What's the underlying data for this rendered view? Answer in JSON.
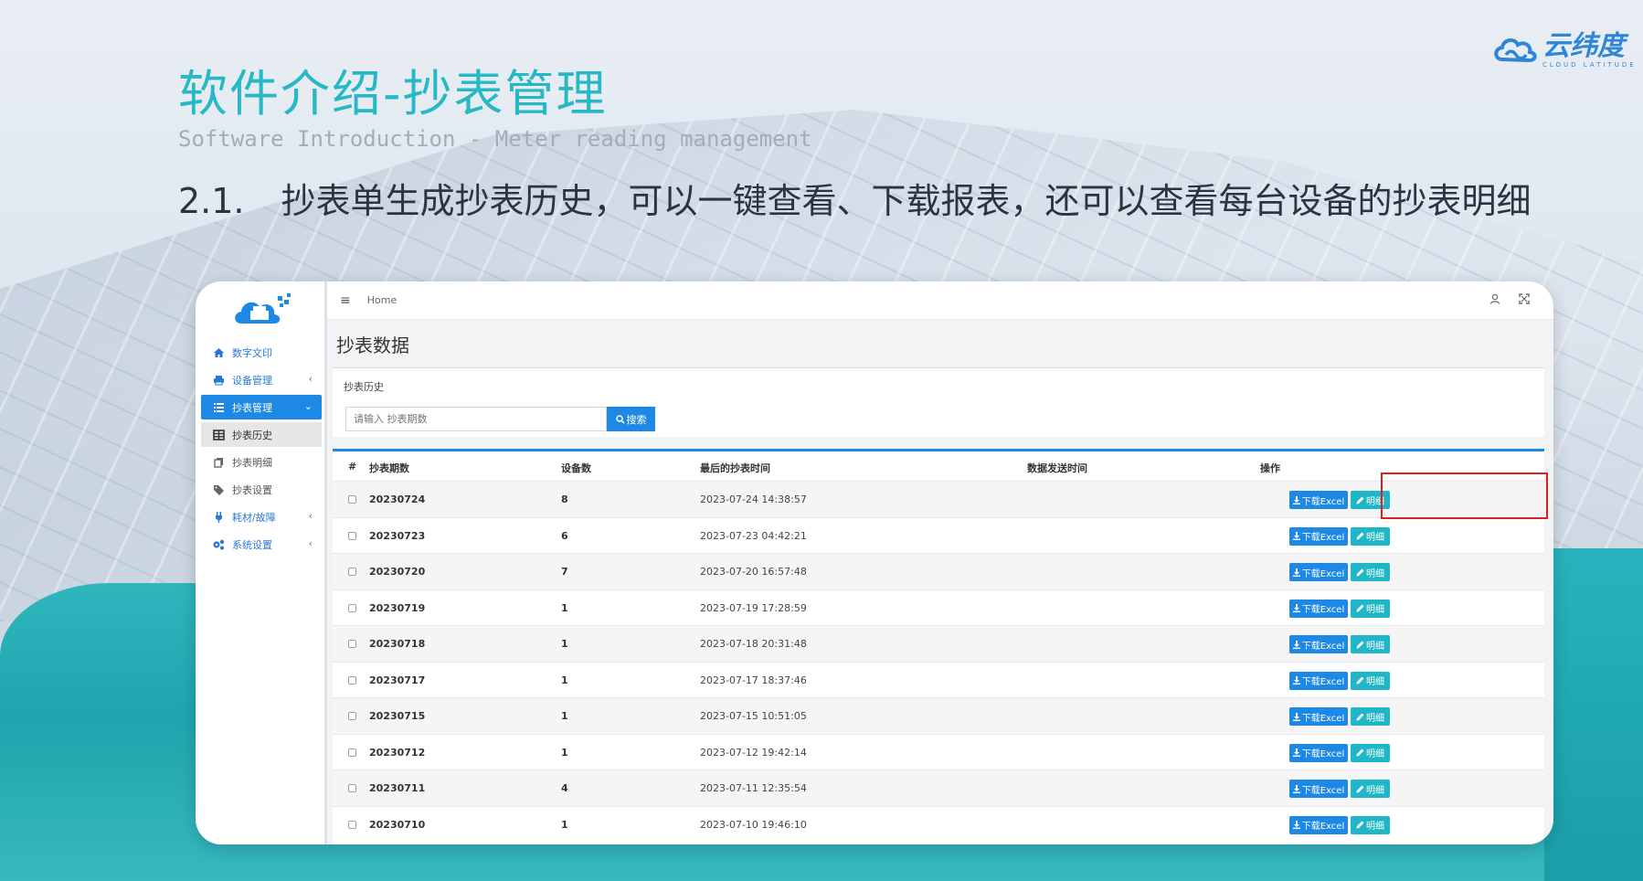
{
  "slide": {
    "title_cn": "软件介绍-抄表管理",
    "title_en": "Software Introduction - Meter reading management",
    "subtitle_num": "2.1.",
    "subtitle_text": "抄表单生成抄表历史，可以一键查看、下载报表，还可以查看每台设备的抄表明细"
  },
  "logo": {
    "name_cn": "云纬度",
    "name_en": "CLOUD LATITUDE",
    "color": "#2f86d6"
  },
  "app": {
    "sidebar": {
      "items": [
        {
          "label": "数字文印",
          "icon": "home-icon"
        },
        {
          "label": "设备管理",
          "icon": "printer-icon",
          "chevron": "‹"
        },
        {
          "label": "抄表管理",
          "icon": "list-icon",
          "chevron": "⌄",
          "active": true
        },
        {
          "label": "抄表历史",
          "icon": "table-icon",
          "sub": true,
          "current": true
        },
        {
          "label": "抄表明细",
          "icon": "copy-icon",
          "sub": true
        },
        {
          "label": "抄表设置",
          "icon": "tags-icon",
          "sub": true
        },
        {
          "label": "耗材/故障",
          "icon": "plug-icon",
          "chevron": "‹"
        },
        {
          "label": "系统设置",
          "icon": "gears-icon",
          "chevron": "‹"
        }
      ]
    },
    "topbar": {
      "breadcrumb": "Home",
      "menu_icon": "≡",
      "user_icon": "user-icon",
      "fullscreen_icon": "expand-icon"
    },
    "page_title": "抄表数据",
    "search": {
      "panel_title": "抄表历史",
      "placeholder": "请输入 抄表期数",
      "button_label": "搜索"
    },
    "table": {
      "columns": [
        "#",
        "抄表期数",
        "设备数",
        "最后的抄表时间",
        "数据发送时间",
        "操作"
      ],
      "rows": [
        {
          "period": "20230724",
          "count": "8",
          "last_time": "2023-07-24 14:38:57",
          "send_time": ""
        },
        {
          "period": "20230723",
          "count": "6",
          "last_time": "2023-07-23 04:42:21",
          "send_time": ""
        },
        {
          "period": "20230720",
          "count": "7",
          "last_time": "2023-07-20 16:57:48",
          "send_time": ""
        },
        {
          "period": "20230719",
          "count": "1",
          "last_time": "2023-07-19 17:28:59",
          "send_time": ""
        },
        {
          "period": "20230718",
          "count": "1",
          "last_time": "2023-07-18 20:31:48",
          "send_time": ""
        },
        {
          "period": "20230717",
          "count": "1",
          "last_time": "2023-07-17 18:37:46",
          "send_time": ""
        },
        {
          "period": "20230715",
          "count": "1",
          "last_time": "2023-07-15 10:51:05",
          "send_time": ""
        },
        {
          "period": "20230712",
          "count": "1",
          "last_time": "2023-07-12 19:42:14",
          "send_time": ""
        },
        {
          "period": "20230711",
          "count": "4",
          "last_time": "2023-07-11 12:35:54",
          "send_time": ""
        },
        {
          "period": "20230710",
          "count": "1",
          "last_time": "2023-07-10 19:46:10",
          "send_time": ""
        }
      ],
      "excel_label": "下载Excel",
      "detail_label": "明细"
    },
    "colors": {
      "primary": "#1e88e5",
      "detail": "#1fb7c7",
      "highlight": "#e02020",
      "title_teal": "#27b8c6"
    }
  }
}
